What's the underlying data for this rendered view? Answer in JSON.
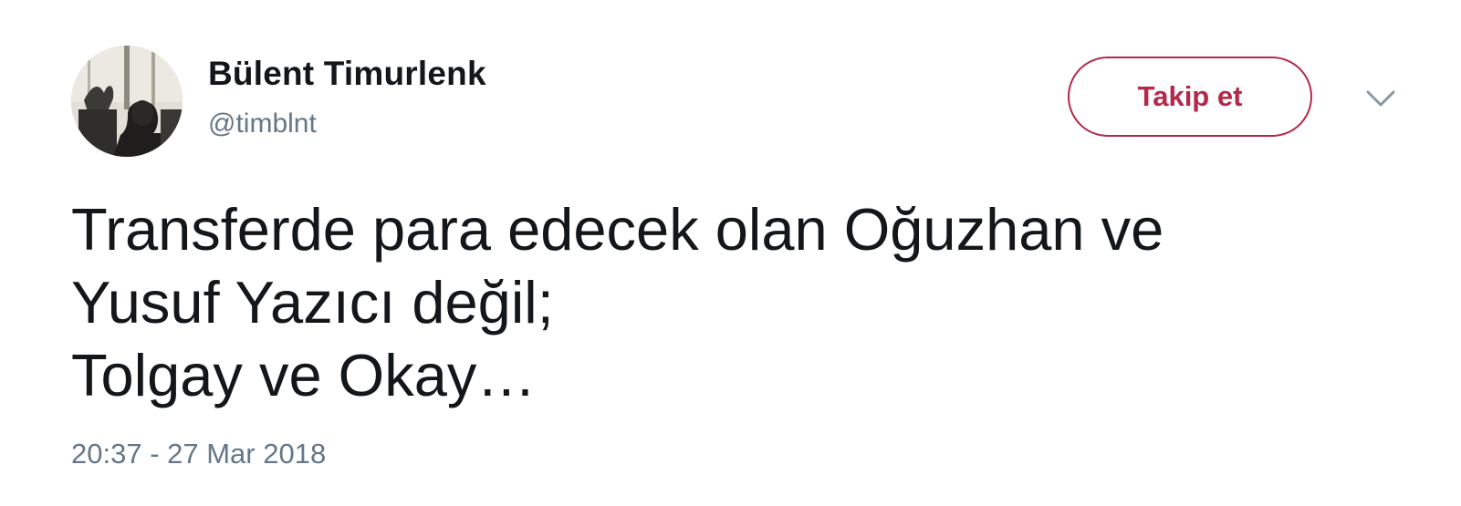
{
  "author": {
    "display_name": "Bülent Timurlenk",
    "handle": "@timblnt",
    "avatar_icon": "profile-photo"
  },
  "actions": {
    "follow_label": "Takip et",
    "follow_color": "#b4294a",
    "menu_icon": "chevron-down-icon"
  },
  "tweet": {
    "lines": [
      "Transferde para edecek olan Oğuzhan ve",
      "Yusuf Yazıcı değil;",
      "Tolgay ve Okay…"
    ],
    "timestamp": "20:37 - 27 Mar 2018"
  }
}
